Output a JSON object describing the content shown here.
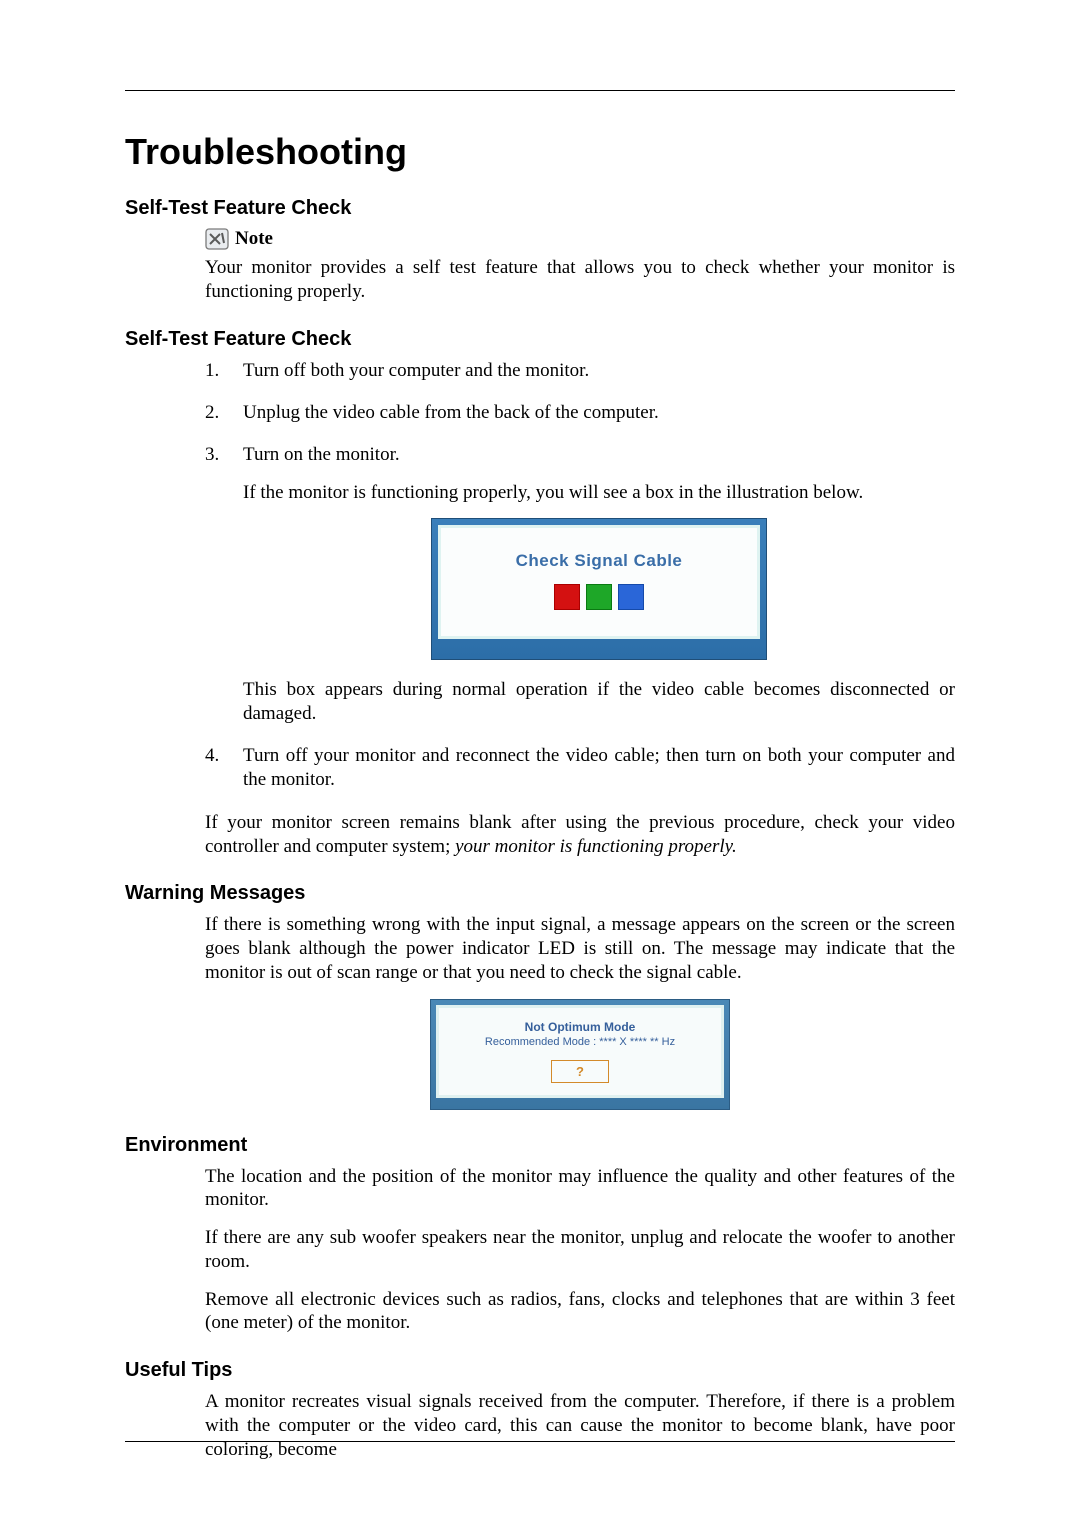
{
  "page": {
    "title": "Troubleshooting"
  },
  "selfTest1": {
    "heading": "Self-Test Feature Check",
    "noteLabel": "Note",
    "intro": "Your monitor provides a self test feature that allows you to check whether your monitor is functioning properly."
  },
  "selfTest2": {
    "heading": "Self-Test Feature Check",
    "steps": {
      "s1": "Turn off both your computer and the monitor.",
      "s2": "Unplug the video cable from the back of the computer.",
      "s3": "Turn on the monitor.",
      "s3b": "If the monitor is functioning properly, you will see a box in the illustration below.",
      "s3c": "This box appears during normal operation if the video cable becomes disconnected or damaged.",
      "s4": "Turn off your monitor and reconnect the video cable; then turn on both your computer and the monitor."
    },
    "closingA": "If your monitor screen remains blank after using the previous procedure, check your video controller and computer system; ",
    "closingB": "your monitor is functioning properly."
  },
  "figure1": {
    "label": "Check Signal Cable"
  },
  "warning": {
    "heading": "Warning Messages",
    "p1": "If there is something wrong with the input signal, a message appears on the screen or the screen goes blank although the power indicator LED is still on. The message may indicate that the monitor is out of scan range or that you need to check the signal cable."
  },
  "figure2": {
    "line1": "Not Optimum Mode",
    "line2": "Recommended Mode : **** X **** ** Hz",
    "qmark": "?"
  },
  "environment": {
    "heading": "Environment",
    "p1": "The location and the position of the monitor may influence the quality and other features of the monitor.",
    "p2": "If there are any sub woofer speakers near the monitor, unplug and relocate the woofer to another room.",
    "p3": "Remove all electronic devices such as radios, fans, clocks and telephones that are within 3 feet (one meter) of the monitor."
  },
  "tips": {
    "heading": "Useful Tips",
    "p1": "A monitor recreates visual signals received from the computer. Therefore, if there is a problem with the computer or the video card, this can cause the monitor to become blank, have poor coloring, become"
  }
}
